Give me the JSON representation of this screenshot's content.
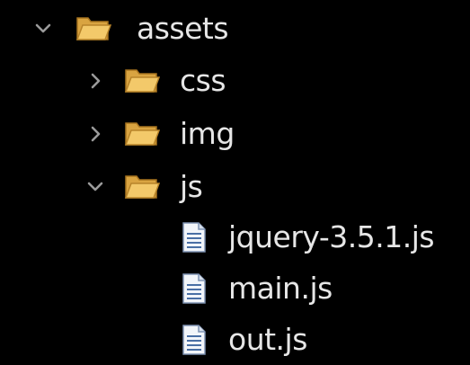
{
  "tree": {
    "items": [
      {
        "label": "assets",
        "type": "folder",
        "expanded": true,
        "icon": "folder-open-icon"
      },
      {
        "label": "css",
        "type": "folder",
        "expanded": false,
        "icon": "folder-open-icon"
      },
      {
        "label": "img",
        "type": "folder",
        "expanded": false,
        "icon": "folder-open-icon"
      },
      {
        "label": "js",
        "type": "folder",
        "expanded": true,
        "icon": "folder-open-icon"
      },
      {
        "label": "jquery-3.5.1.js",
        "type": "file",
        "icon": "text-file-icon"
      },
      {
        "label": "main.js",
        "type": "file",
        "icon": "text-file-icon"
      },
      {
        "label": "out.js",
        "type": "file",
        "icon": "text-file-icon"
      }
    ]
  },
  "colors": {
    "background": "#000000",
    "text": "#e6e6e6",
    "chevron": "#9a9a9a",
    "folder_back": "#d9a441",
    "folder_front": "#f3c96a",
    "file_body": "#f2f5fa",
    "file_lines": "#4a6fa5"
  }
}
